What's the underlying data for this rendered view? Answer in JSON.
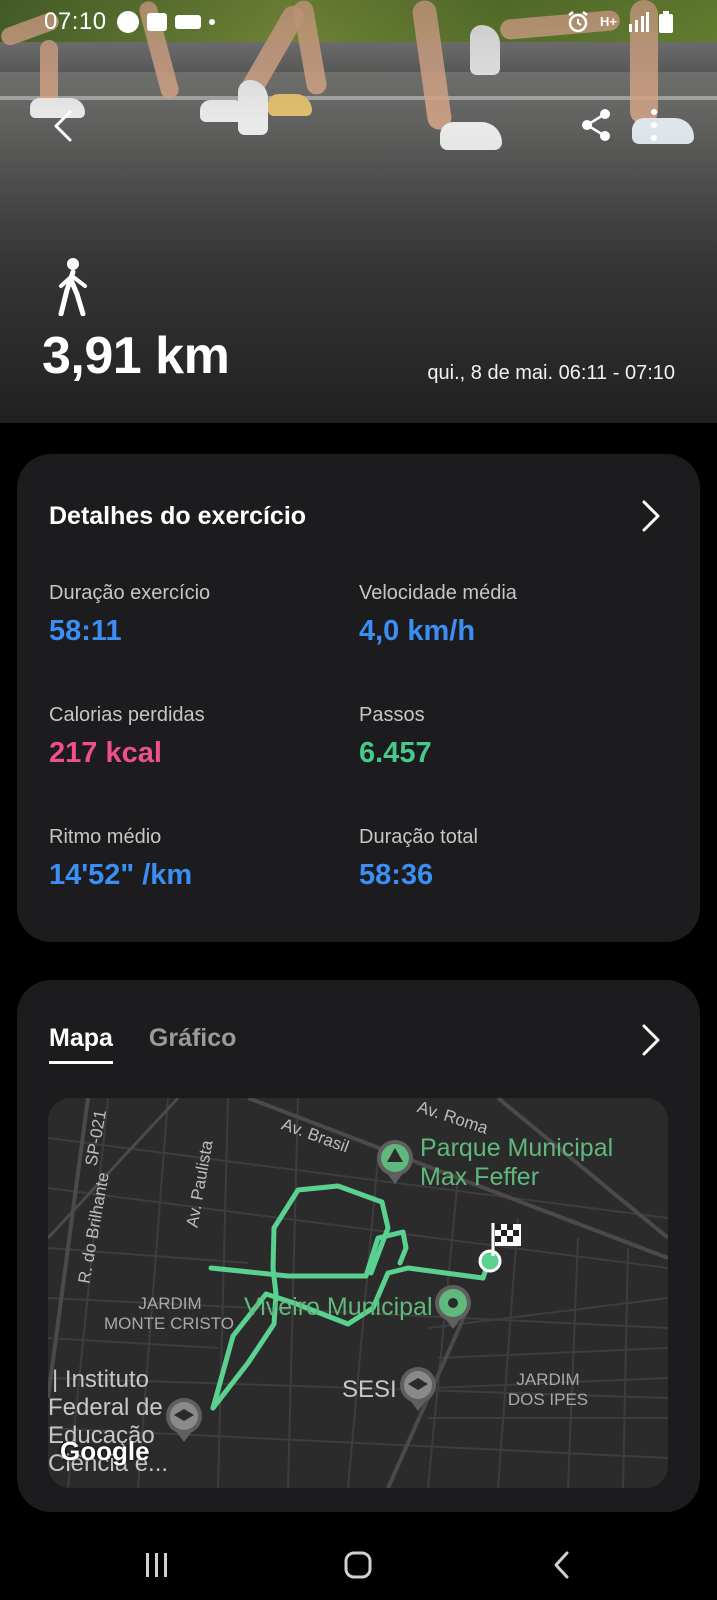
{
  "status_bar": {
    "time": "07:10",
    "network": "H+"
  },
  "hero": {
    "distance": "3,91 km",
    "datetime": "qui., 8 de mai. 06:11 - 07:10"
  },
  "details": {
    "title": "Detalhes do exercício",
    "stats": [
      {
        "label": "Duração exercício",
        "value": "58:11",
        "color": "#3b8ef3"
      },
      {
        "label": "Velocidade média",
        "value": "4,0 km/h",
        "color": "#3b8ef3"
      },
      {
        "label": "Calorias perdidas",
        "value": "217 kcal",
        "color": "#f0508a"
      },
      {
        "label": "Passos",
        "value": "6.457",
        "color": "#46c98b"
      },
      {
        "label": "Ritmo médio",
        "value": "14'52\" /km",
        "color": "#3b8ef3"
      },
      {
        "label": "Duração total",
        "value": "58:36",
        "color": "#3b8ef3"
      }
    ]
  },
  "map_card": {
    "tabs": [
      {
        "label": "Mapa",
        "active": true
      },
      {
        "label": "Gráfico",
        "active": false
      }
    ],
    "map": {
      "parks": [
        "Parque Municipal",
        "Max Feffer",
        "Viveiro Municipal"
      ],
      "places": [
        "SESI",
        "| Instituto",
        "Federal de",
        "Educação",
        "Ciência e..."
      ],
      "districts": [
        "JARDIM",
        "MONTE CRISTO",
        "JARDIM",
        "DOS IPES"
      ],
      "streets": [
        "Av. Roma",
        "Av. Brasil",
        "SP-021",
        "Av. Paulista",
        "R. do Brilhante"
      ],
      "attribution": "Google",
      "route_color": "#5ad18e"
    }
  },
  "icons": {
    "back": "back-arrow-icon",
    "share": "share-icon",
    "more": "more-vertical-icon",
    "activity": "walking-person-icon",
    "chevron": "chevron-right-icon"
  }
}
